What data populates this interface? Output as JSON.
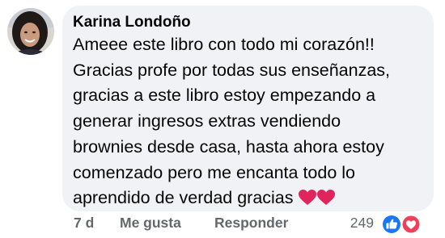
{
  "comment": {
    "author": "Karina Londoño",
    "lines": [
      "Ameee este libro con todo mi corazón!!",
      "Gracias profe por todas sus enseñanzas,",
      "gracias a este libro estoy empezando a",
      "generar ingresos extras vendiendo",
      "brownies desde casa, hasta ahora estoy",
      "comenzado pero me encanta todo lo",
      "aprendido de verdad gracias"
    ],
    "trailing_emoji": "red-heart-icon x2"
  },
  "actions": {
    "time": "7 d",
    "like_label": "Me gusta",
    "reply_label": "Responder",
    "reaction_count": "249",
    "reaction_icons": [
      "like-icon",
      "love-icon"
    ]
  },
  "colors": {
    "bubble_bg": "#f0f2f5",
    "text": "#050505",
    "secondary": "#65676b",
    "like_blue": "#1877f2",
    "love_red": "#f33e58"
  }
}
